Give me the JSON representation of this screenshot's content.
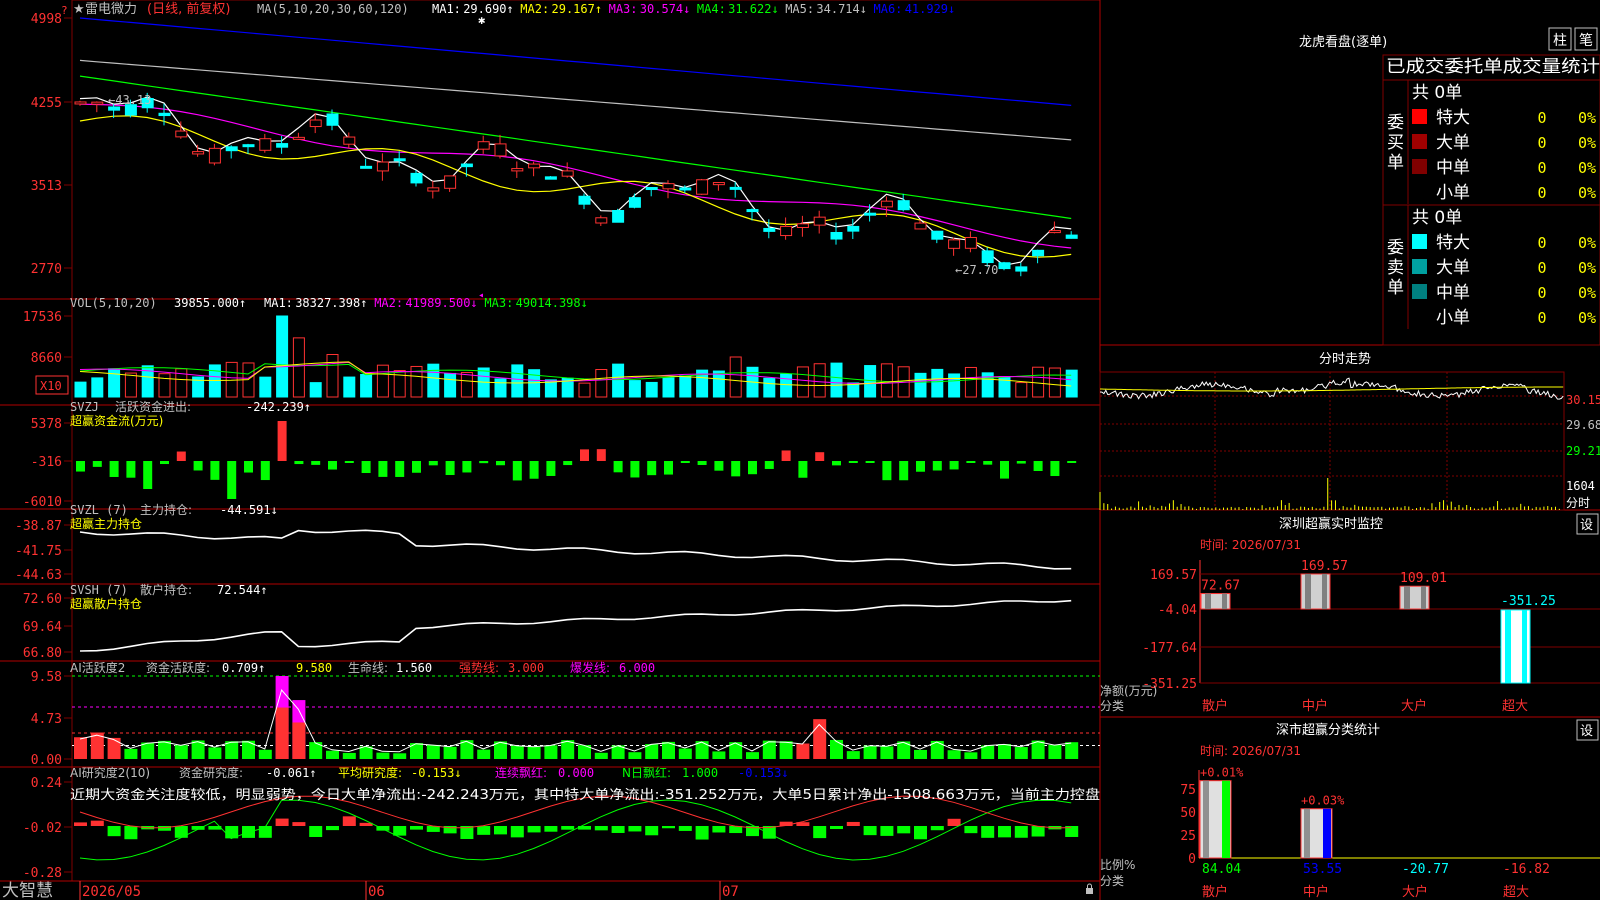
{
  "app": {
    "logo": "大智慧",
    "help": "?"
  },
  "stock": {
    "star": "★",
    "name": "雷电微力",
    "mode": "(日线, 前复权)"
  },
  "colors": {
    "up": "#ff3232",
    "down": "#00ffff",
    "ma1": "#ffffff",
    "ma2": "#ffff00",
    "ma3": "#ff00ff",
    "ma4": "#00ff00",
    "ma5": "#c0c0c0",
    "ma6": "#0000ff",
    "grid": "#800000"
  },
  "panels": {
    "price": {
      "params": "MA(5,10,20,30,60,120)",
      "ma_items": [
        {
          "label": "MA1:",
          "value": "29.690↑",
          "color": "#ffffff"
        },
        {
          "label": "MA2:",
          "value": "29.167↑",
          "color": "#ffff00"
        },
        {
          "label": "MA3:",
          "value": "30.574↓",
          "color": "#ff00ff"
        },
        {
          "label": "MA4:",
          "value": "31.622↓",
          "color": "#00ff00"
        },
        {
          "label": "MA5:",
          "value": "34.714↓",
          "color": "#c0c0c0"
        },
        {
          "label": "MA6:",
          "value": "41.929↓",
          "color": "#0000ff"
        }
      ],
      "axis": [
        "4998",
        "4255",
        "3513",
        "2770"
      ],
      "high_note": "←43.13",
      "low_note": "←27.70"
    },
    "volume": {
      "label": "VOL(5,10,20)",
      "value": "39855.000↑",
      "ma_items": [
        {
          "label": "MA1:",
          "value": "38327.398↑",
          "color": "#ffffff"
        },
        {
          "label": "MA2:",
          "value": "41989.500↓",
          "color": "#ff00ff"
        },
        {
          "label": "MA3:",
          "value": "49014.398↓",
          "color": "#00ff00"
        }
      ],
      "axis": [
        "17536",
        "8660"
      ],
      "unit": "X10"
    },
    "svzj": {
      "label": "SVZJ",
      "title": "活跃资金进出:",
      "value": "-242.239↑",
      "subtitle": "超赢资金流(万元)",
      "axis": [
        "5378",
        "-316",
        "-6010"
      ]
    },
    "svzl": {
      "label": "SVZL (7)",
      "title": "主力持仓:",
      "value": "-44.591↓",
      "subtitle": "超赢主力持仓",
      "axis": [
        "-38.87",
        "-41.75",
        "-44.63"
      ]
    },
    "svsh": {
      "label": "SVSH (7)",
      "title": "散户持仓:",
      "value": "72.544↑",
      "subtitle": "超赢散户持仓",
      "axis": [
        "72.60",
        "69.64",
        "66.80"
      ]
    },
    "ai1": {
      "label": "AI活跃度2",
      "title": "资金活跃度:",
      "value": "0.709↑",
      "value2": "9.580",
      "life_label": "生命线:",
      "life_value": "1.560",
      "strong_label": "强势线:",
      "strong_value": "3.000",
      "burst_label": "爆发线:",
      "burst_value": "6.000",
      "axis": [
        "9.58",
        "4.73",
        "0.00"
      ]
    },
    "ai2": {
      "label": "AI研究度2(10)",
      "title": "资金研究度:",
      "value": "-0.061↑",
      "avg_label": "平均研究度:",
      "avg_value": "-0.153↓",
      "cont_label": "连续飘红:",
      "cont_value": "0.000",
      "nred_label": "N日飘红:",
      "nred_value": "1.000",
      "tail_value": "-0.153↓",
      "comment": "近期大资金关注度较低，明显弱势，今日大单净流出:-242.243万元，其中特大单净流出:-351.252万元，大单5日累计净出-1508.663万元，当前主力控盘",
      "axis": [
        "0.24",
        "-0.02",
        "-0.28"
      ]
    }
  },
  "date_axis": [
    "2026/05",
    "06",
    "07"
  ],
  "right": {
    "dragon": {
      "title": "龙虎看盘(逐单)",
      "btn1": "柱",
      "btn2": "笔",
      "tab_text": "已成交委托单成交量统计"
    },
    "buy": {
      "side_label": "委买单",
      "total": "共 0单",
      "rows": [
        {
          "name": "特大",
          "count": "0",
          "pct": "0%",
          "color": "#ff0000"
        },
        {
          "name": "大单",
          "count": "0",
          "pct": "0%",
          "color": "#a00000"
        },
        {
          "name": "中单",
          "count": "0",
          "pct": "0%",
          "color": "#800000"
        },
        {
          "name": "小单",
          "count": "0",
          "pct": "0%",
          "color": ""
        }
      ]
    },
    "sell": {
      "side_label": "委卖单",
      "total": "共 0单",
      "rows": [
        {
          "name": "特大",
          "count": "0",
          "pct": "0%",
          "color": "#00ffff"
        },
        {
          "name": "大单",
          "count": "0",
          "pct": "0%",
          "color": "#00a0a0"
        },
        {
          "name": "中单",
          "count": "0",
          "pct": "0%",
          "color": "#008080"
        },
        {
          "name": "小单",
          "count": "0",
          "pct": "0%",
          "color": ""
        }
      ]
    },
    "intraday": {
      "title": "分时走势",
      "axis": [
        "30.15",
        "29.68",
        "29.21"
      ],
      "vol_axis": [
        "1604",
        "分时"
      ]
    },
    "monitor": {
      "title": "深圳超赢实时监控",
      "set": "设",
      "time": "时间: 2026/07/31",
      "axis": [
        "169.57",
        "-4.04",
        "-177.64",
        "-351.25"
      ],
      "net_label": "净额(万元)",
      "cat_label": "分类",
      "bars": [
        {
          "cat": "散户",
          "value": 72.67,
          "text": "72.67"
        },
        {
          "cat": "中户",
          "value": 169.57,
          "text": "169.57"
        },
        {
          "cat": "大户",
          "value": 109.01,
          "text": "109.01"
        },
        {
          "cat": "超大",
          "value": -351.25,
          "text": "-351.25"
        }
      ]
    },
    "classify": {
      "title": "深市超赢分类统计",
      "set": "设",
      "time": "时间: 2026/07/31",
      "axis": [
        "75",
        "50",
        "25",
        "0"
      ],
      "ratio_label": "比例%",
      "cat_label": "分类",
      "bars": [
        {
          "cat": "散户",
          "pct": "+0.01%",
          "height": 84.04,
          "value": "84.04",
          "kind": "green"
        },
        {
          "cat": "中户",
          "pct": "+0.03%",
          "height": 53.55,
          "value": "53.55",
          "kind": "blue"
        },
        {
          "cat": "大户",
          "pct": "",
          "height": 0,
          "value": "-20.77",
          "kind": "none"
        },
        {
          "cat": "超大",
          "pct": "",
          "height": 0,
          "value": "-16.82",
          "kind": "none"
        }
      ]
    }
  }
}
